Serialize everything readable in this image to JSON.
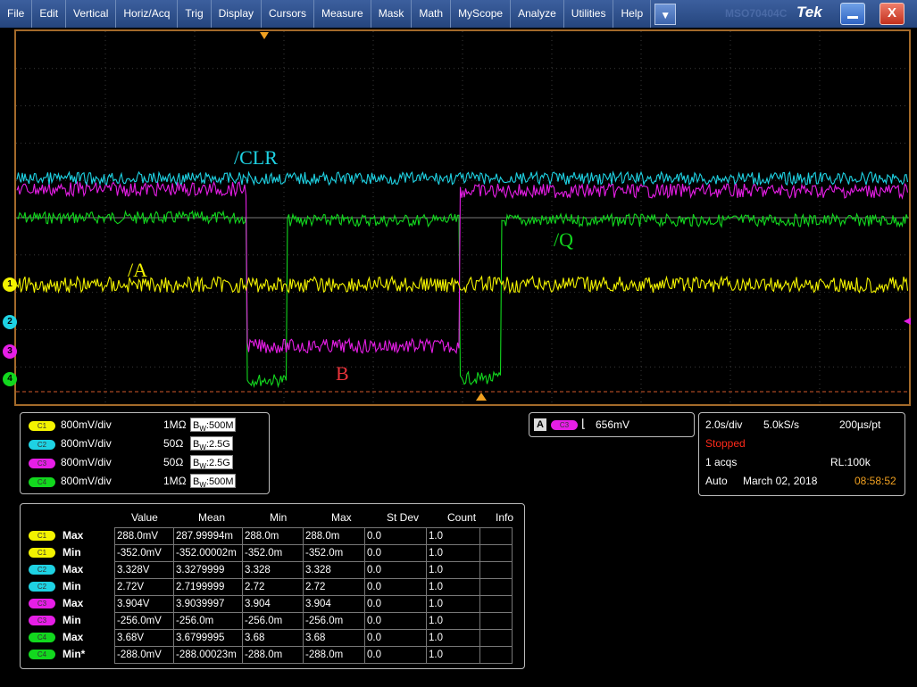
{
  "menu": [
    "File",
    "Edit",
    "Vertical",
    "Horiz/Acq",
    "Trig",
    "Display",
    "Cursors",
    "Measure",
    "Mask",
    "Math",
    "MyScope",
    "Analyze",
    "Utilities",
    "Help"
  ],
  "menu_arrow": "▼",
  "watermark": "MSO70404C",
  "brand": "Tek",
  "close_glyph": "X",
  "waveform_labels": {
    "clr": "/CLR",
    "q": "/Q",
    "a": "/A",
    "b": "B"
  },
  "channel_markers": [
    "1",
    "2",
    "3",
    "4"
  ],
  "colors": {
    "ch1": "#f3f300",
    "ch2": "#1ed2e3",
    "ch3": "#e61ee6",
    "ch4": "#12d81e",
    "label_red": "#e8333a",
    "bezel": "#a36a2a"
  },
  "channels": [
    {
      "badge": "C1",
      "scale": "800mV/div",
      "impedance": "1MΩ",
      "bw_prefix": "B",
      "bw_sub": "W",
      "bw_value": ":500M"
    },
    {
      "badge": "C2",
      "scale": "800mV/div",
      "impedance": "50Ω",
      "bw_prefix": "B",
      "bw_sub": "W",
      "bw_value": ":2.5G"
    },
    {
      "badge": "C3",
      "scale": "800mV/div",
      "impedance": "50Ω",
      "bw_prefix": "B",
      "bw_sub": "W",
      "bw_value": ":2.5G"
    },
    {
      "badge": "C4",
      "scale": "800mV/div",
      "impedance": "1MΩ",
      "bw_prefix": "B",
      "bw_sub": "W",
      "bw_value": ":500M"
    }
  ],
  "trigger": {
    "source_letter": "A",
    "channel": "C3",
    "slope_glyph": "⌊",
    "level": "656mV"
  },
  "acquisition": {
    "time_div": "2.0s/div",
    "sample_rate": "5.0kS/s",
    "point_time": "200µs/pt",
    "state": "Stopped",
    "acqs": "1 acqs",
    "record_length": "RL:100k",
    "mode": "Auto",
    "date": "March 02, 2018",
    "time": "08:58:52"
  },
  "measurements": {
    "headers": [
      "Value",
      "Mean",
      "Min",
      "Max",
      "St Dev",
      "Count",
      "Info"
    ],
    "rows": [
      {
        "ch": "C1",
        "label": "Max",
        "value": "288.0mV",
        "mean": "287.99994m",
        "min": "288.0m",
        "max": "288.0m",
        "stdev": "0.0",
        "count": "1.0",
        "info": ""
      },
      {
        "ch": "C1",
        "label": "Min",
        "value": "-352.0mV",
        "mean": "-352.00002m",
        "min": "-352.0m",
        "max": "-352.0m",
        "stdev": "0.0",
        "count": "1.0",
        "info": ""
      },
      {
        "ch": "C2",
        "label": "Max",
        "value": "3.328V",
        "mean": "3.3279999",
        "min": "3.328",
        "max": "3.328",
        "stdev": "0.0",
        "count": "1.0",
        "info": ""
      },
      {
        "ch": "C2",
        "label": "Min",
        "value": "2.72V",
        "mean": "2.7199999",
        "min": "2.72",
        "max": "2.72",
        "stdev": "0.0",
        "count": "1.0",
        "info": ""
      },
      {
        "ch": "C3",
        "label": "Max",
        "value": "3.904V",
        "mean": "3.9039997",
        "min": "3.904",
        "max": "3.904",
        "stdev": "0.0",
        "count": "1.0",
        "info": ""
      },
      {
        "ch": "C3",
        "label": "Min",
        "value": "-256.0mV",
        "mean": "-256.0m",
        "min": "-256.0m",
        "max": "-256.0m",
        "stdev": "0.0",
        "count": "1.0",
        "info": ""
      },
      {
        "ch": "C4",
        "label": "Max",
        "value": "3.68V",
        "mean": "3.6799995",
        "min": "3.68",
        "max": "3.68",
        "stdev": "0.0",
        "count": "1.0",
        "info": ""
      },
      {
        "ch": "C4",
        "label": "Min*",
        "value": "-288.0mV",
        "mean": "-288.00023m",
        "min": "-288.0m",
        "max": "-288.0m",
        "stdev": "0.0",
        "count": "1.0",
        "info": ""
      }
    ]
  }
}
